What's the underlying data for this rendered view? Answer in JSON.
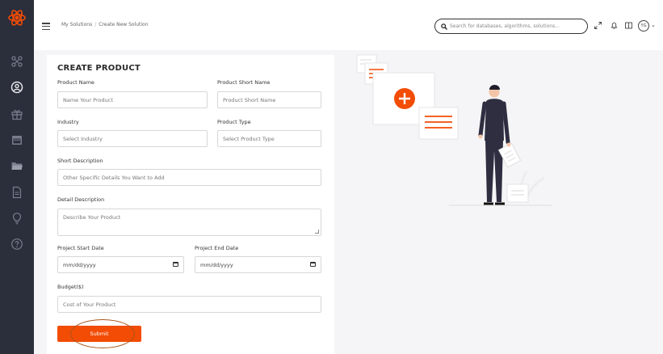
{
  "breadcrumb": {
    "parent": "My Solutions",
    "separator": "/",
    "current": "Create New Solution"
  },
  "search": {
    "placeholder": "Search for databases, algorithms, solutions..."
  },
  "user": {
    "initials": "YG"
  },
  "icons": {
    "logo": "atom-logo-icon",
    "sidebar": [
      "network-icon",
      "user-circle-icon",
      "gift-icon",
      "calendar-icon",
      "folder-icon",
      "document-icon",
      "lightbulb-icon",
      "help-icon"
    ],
    "header": [
      "menu-icon",
      "search-icon",
      "expand-icon",
      "bell-icon",
      "columns-icon",
      "chevron-down-icon"
    ]
  },
  "colors": {
    "accent": "#f24c05",
    "sidebar": "#2b2e3b",
    "annotation_circle": "#a9551a"
  },
  "form": {
    "title": "CREATE PRODUCT",
    "product_name": {
      "label": "Product Name",
      "placeholder": "Name Your Product"
    },
    "product_short_name": {
      "label": "Product Short Name",
      "placeholder": "Product Short Name"
    },
    "industry": {
      "label": "Industry",
      "placeholder": "Select Industry"
    },
    "product_type": {
      "label": "Product Type",
      "placeholder": "Select Product Type"
    },
    "short_description": {
      "label": "Short Description",
      "placeholder": "Other Specific Details You Want to Add"
    },
    "detail_description": {
      "label": "Detail Description",
      "placeholder": "Describe Your Product"
    },
    "start_date": {
      "label": "Project Start Date",
      "value": "mm/dd/yyyy"
    },
    "end_date": {
      "label": "Project End Date",
      "value": "mm/dd/yyyy"
    },
    "budget": {
      "label": "Budget($)",
      "placeholder": "Cost of Your Product"
    },
    "submit_label": "Submit"
  }
}
